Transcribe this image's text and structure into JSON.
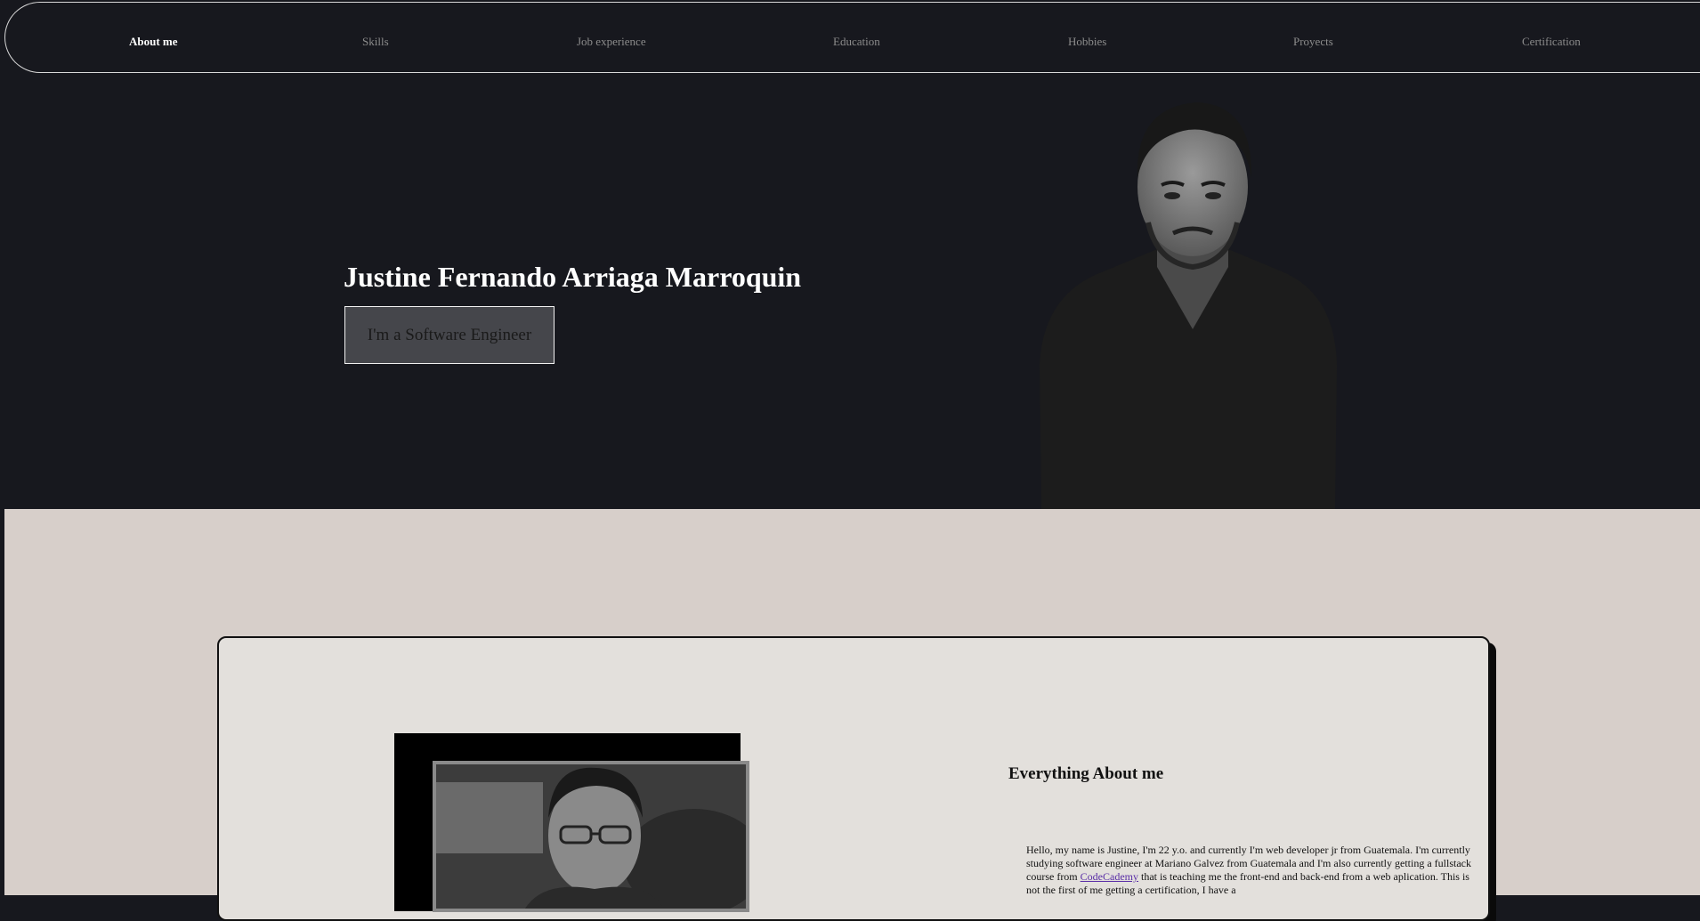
{
  "nav": {
    "items": [
      {
        "label": "About me",
        "active": true
      },
      {
        "label": "Skills",
        "active": false
      },
      {
        "label": "Job experience",
        "active": false
      },
      {
        "label": "Education",
        "active": false
      },
      {
        "label": "Hobbies",
        "active": false
      },
      {
        "label": "Proyects",
        "active": false
      },
      {
        "label": "Certification",
        "active": false
      }
    ]
  },
  "hero": {
    "name": "Justine Fernando Arriaga Marroquin",
    "button_label": "I'm a Software Engineer"
  },
  "about": {
    "title": "Everything About me",
    "text_before_link": "Hello, my name is Justine, I'm 22 y.o. and currently I'm web developer jr from Guatemala. I'm currently studying software engineer at Mariano Galvez from Guatemala and I'm also currently getting a fullstack course from ",
    "link_label": "CodeCademy",
    "text_after_link": " that is teaching me the front-end and back-end from a web aplication. This is not the first of me getting a certification, I have a"
  },
  "colors": {
    "background_dark": "#17181e",
    "section_light": "#d7cfca",
    "card": "#e3e0dc",
    "link": "#5a2ea6"
  }
}
